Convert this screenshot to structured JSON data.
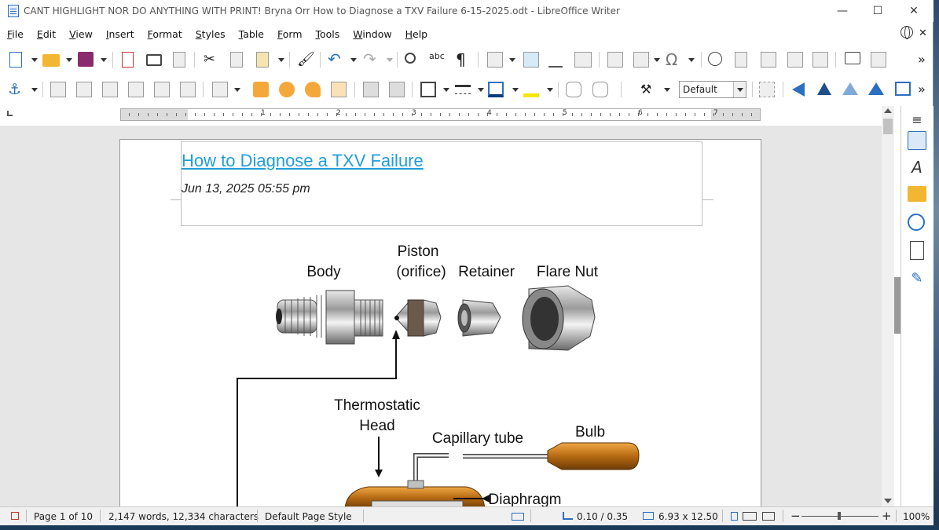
{
  "window": {
    "title": "CANT HIGHLIGHT NOR DO ANYTHING WITH PRINT! Bryna Orr How to Diagnose a TXV Failure  6-15-2025.odt - LibreOffice Writer",
    "minimize": "—",
    "maximize": "☐",
    "close": "✕"
  },
  "menu": {
    "items": [
      {
        "key": "F",
        "rest": "ile"
      },
      {
        "key": "E",
        "rest": "dit"
      },
      {
        "key": "V",
        "rest": "iew"
      },
      {
        "key": "I",
        "rest": "nsert"
      },
      {
        "key": "F",
        "rest": "ormat"
      },
      {
        "key": "S",
        "rest": "tyles"
      },
      {
        "key": "T",
        "rest": "able"
      },
      {
        "key": "F",
        "rest": "orm"
      },
      {
        "key": "T",
        "rest": "ools"
      },
      {
        "key": "W",
        "rest": "indow"
      },
      {
        "key": "H",
        "rest": "elp"
      }
    ],
    "close_doc": "✕"
  },
  "toolbar2": {
    "paragraph_style": "Default"
  },
  "ruler": {
    "numbers": [
      "1",
      "2",
      "3",
      "4",
      "5",
      "6",
      "7"
    ]
  },
  "document": {
    "heading": "How to Diagnose a TXV Failure",
    "date": "Jun 13, 2025 05:55 pm",
    "figure": {
      "labels": {
        "body": "Body",
        "piston_1": "Piston",
        "piston_2": "(orifice)",
        "retainer": "Retainer",
        "flare_nut": "Flare Nut",
        "thermo_1": "Thermostatic",
        "thermo_2": "Head",
        "capillary": "Capillary tube",
        "bulb": "Bulb",
        "diaphragm": "Diaphragm"
      }
    }
  },
  "status": {
    "page": "Page 1 of 10",
    "words": "2,147 words, 12,334 characters",
    "page_style": "Default Page Style",
    "position": "0.10 / 0.35",
    "size": "6.93 x 12.50",
    "zoom": "100%",
    "zoom_minus": "−",
    "zoom_plus": "+"
  }
}
